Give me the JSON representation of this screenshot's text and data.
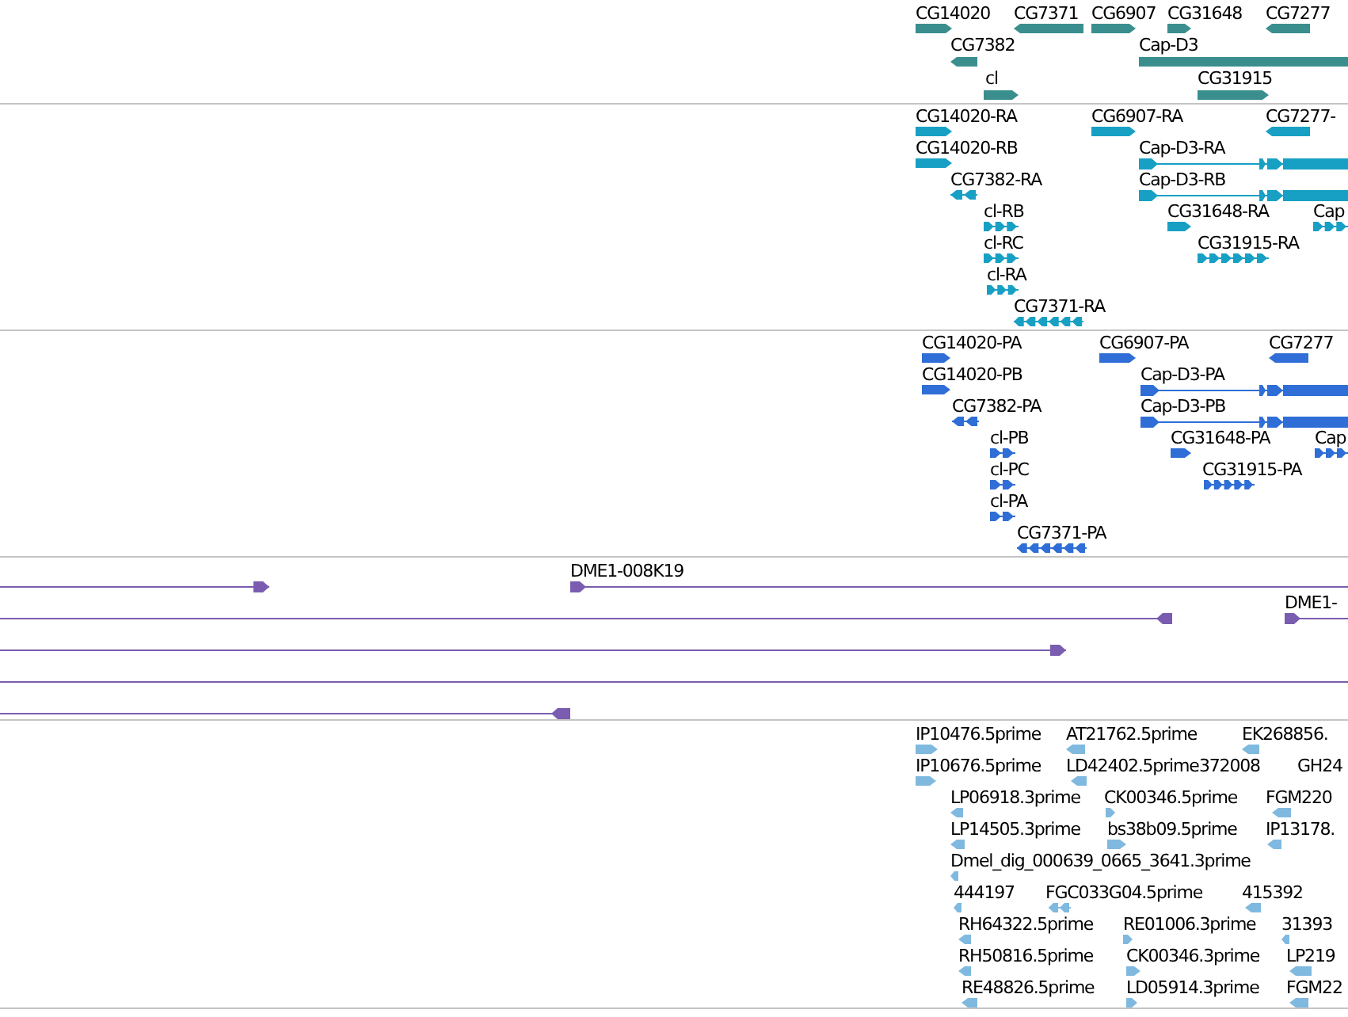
{
  "tracks": [
    {
      "kind": "genes",
      "color": "#3b8e8e",
      "features": [
        {
          "label": "CG14020",
          "reverse": false,
          "kind": "block"
        },
        {
          "label": "CG7371",
          "reverse": true,
          "kind": "block"
        },
        {
          "label": "CG6907",
          "reverse": false,
          "kind": "block"
        },
        {
          "label": "CG31648",
          "reverse": false,
          "kind": "block"
        },
        {
          "label": "CG7277",
          "reverse": true,
          "kind": "block"
        },
        {
          "label": "CG7382",
          "reverse": true,
          "kind": "block"
        },
        {
          "label": "Cap-D3",
          "kind": "block"
        },
        {
          "label": "cl",
          "reverse": false,
          "kind": "block"
        },
        {
          "label": "CG31915",
          "reverse": false,
          "kind": "block"
        }
      ]
    },
    {
      "kind": "transcripts",
      "color": "#17a0c4",
      "features": [
        {
          "label": "CG14020-RA",
          "reverse": false,
          "kind": "block"
        },
        {
          "label": "CG6907-RA",
          "reverse": false,
          "kind": "block"
        },
        {
          "label": "CG7277-",
          "reverse": true,
          "kind": "block"
        },
        {
          "label": "CG14020-RB",
          "reverse": false,
          "kind": "block"
        },
        {
          "label": "Cap-D3-RA",
          "reverse": false,
          "kind": "spliced"
        },
        {
          "label": "CG7382-RA",
          "reverse": true,
          "kind": "exons"
        },
        {
          "label": "Cap-D3-RB",
          "reverse": false,
          "kind": "spliced"
        },
        {
          "label": "cl-RB",
          "reverse": false,
          "kind": "exons"
        },
        {
          "label": "CG31648-RA",
          "reverse": false,
          "kind": "block"
        },
        {
          "label": "Cap",
          "reverse": false,
          "kind": "exons"
        },
        {
          "label": "cl-RC",
          "reverse": false,
          "kind": "exons"
        },
        {
          "label": "CG31915-RA",
          "reverse": false,
          "kind": "exons"
        },
        {
          "label": "cl-RA",
          "reverse": false,
          "kind": "exons"
        },
        {
          "label": "CG7371-RA",
          "reverse": true,
          "kind": "exons"
        }
      ]
    },
    {
      "kind": "proteins",
      "color": "#2f6ed6",
      "features": [
        {
          "label": "CG14020-PA",
          "reverse": false,
          "kind": "block"
        },
        {
          "label": "CG6907-PA",
          "reverse": false,
          "kind": "block"
        },
        {
          "label": "CG7277",
          "reverse": true,
          "kind": "block"
        },
        {
          "label": "CG14020-PB",
          "reverse": false,
          "kind": "block"
        },
        {
          "label": "Cap-D3-PA",
          "reverse": false,
          "kind": "spliced"
        },
        {
          "label": "CG7382-PA",
          "reverse": true,
          "kind": "exons"
        },
        {
          "label": "Cap-D3-PB",
          "reverse": false,
          "kind": "spliced"
        },
        {
          "label": "cl-PB",
          "reverse": false,
          "kind": "exons"
        },
        {
          "label": "CG31648-PA",
          "reverse": false,
          "kind": "block"
        },
        {
          "label": "Cap",
          "reverse": false,
          "kind": "exons"
        },
        {
          "label": "cl-PC",
          "reverse": false,
          "kind": "exons"
        },
        {
          "label": "CG31915-PA",
          "reverse": false,
          "kind": "exons"
        },
        {
          "label": "cl-PA",
          "reverse": false,
          "kind": "exons"
        },
        {
          "label": "CG7371-PA",
          "reverse": true,
          "kind": "exons"
        }
      ]
    },
    {
      "kind": "clones",
      "color": "#7a5cb0",
      "features": [
        {
          "reverse": false,
          "kind": "line"
        },
        {
          "label": "DME1-008K19",
          "reverse": false,
          "kind": "line"
        },
        {
          "reverse": true,
          "kind": "line"
        },
        {
          "label": "DME1-",
          "reverse": false,
          "kind": "line"
        },
        {
          "reverse": false,
          "kind": "line"
        },
        {
          "kind": "line"
        },
        {
          "reverse": true,
          "kind": "line"
        }
      ]
    },
    {
      "kind": "ests",
      "color": "#80b9df",
      "features": [
        {
          "label": "IP10476.5prime",
          "reverse": false,
          "kind": "block"
        },
        {
          "label": "AT21762.5prime",
          "reverse": true,
          "kind": "block"
        },
        {
          "label": "EK268856.",
          "reverse": true,
          "kind": "block"
        },
        {
          "label": "IP10676.5prime",
          "reverse": false,
          "kind": "block"
        },
        {
          "label": "LD42402.5prime",
          "reverse": true,
          "kind": "block"
        },
        {
          "label": "372008",
          "kind": "none"
        },
        {
          "label": "GH24",
          "kind": "none"
        },
        {
          "label": "LP06918.3prime",
          "reverse": true,
          "kind": "block"
        },
        {
          "label": "CK00346.5prime",
          "reverse": false,
          "kind": "block"
        },
        {
          "label": "FGM220",
          "reverse": true,
          "kind": "block"
        },
        {
          "label": "LP14505.3prime",
          "reverse": true,
          "kind": "block"
        },
        {
          "label": "bs38b09.5prime",
          "reverse": false,
          "kind": "block"
        },
        {
          "label": "IP13178.",
          "reverse": true,
          "kind": "block"
        },
        {
          "label": "Dmel_dig_000639_0665_3641.3prime",
          "reverse": true,
          "kind": "block"
        },
        {
          "label": "444197",
          "reverse": true,
          "kind": "block"
        },
        {
          "label": "FGC033G04.5prime",
          "reverse": true,
          "kind": "exons"
        },
        {
          "label": "415392",
          "reverse": true,
          "kind": "block"
        },
        {
          "label": "RH64322.5prime",
          "reverse": true,
          "kind": "block"
        },
        {
          "label": "RE01006.3prime",
          "reverse": false,
          "kind": "block"
        },
        {
          "label": "31393",
          "reverse": true,
          "kind": "block"
        },
        {
          "label": "RH50816.5prime",
          "reverse": true,
          "kind": "block"
        },
        {
          "label": "CK00346.3prime",
          "reverse": false,
          "kind": "block"
        },
        {
          "label": "LP219",
          "reverse": true,
          "kind": "block"
        },
        {
          "label": "RE48826.5prime",
          "reverse": true,
          "kind": "block"
        },
        {
          "label": "LD05914.3prime",
          "reverse": false,
          "kind": "block"
        },
        {
          "label": "FGM22",
          "reverse": true,
          "kind": "block"
        }
      ]
    }
  ]
}
